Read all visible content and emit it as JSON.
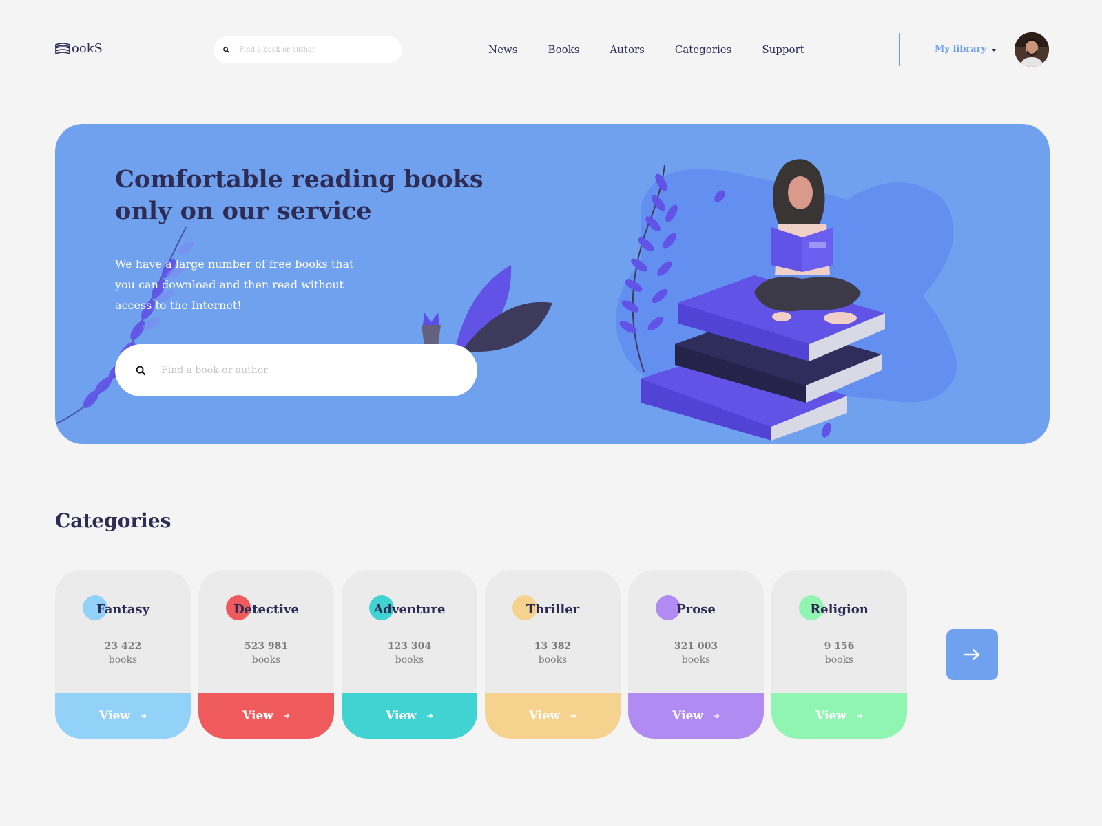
{
  "header": {
    "logo_text": "ookS",
    "search": {
      "placeholder": "Find a book or author"
    },
    "nav": [
      "News",
      "Books",
      "Autors",
      "Categories",
      "Support"
    ],
    "library_label": "My library"
  },
  "hero": {
    "title_line1": "Comfortable reading books",
    "title_line2": "only on our service",
    "description_line1": "We have a large number of free books that",
    "description_line2": "you can download and then read without",
    "description_line3": "access to the Internet!",
    "search": {
      "placeholder": "Find a book or author"
    }
  },
  "categories": {
    "title": "Categories",
    "items": [
      {
        "name": "Fantasy",
        "count": "23 422",
        "unit": "books",
        "action": "View",
        "color": "#93d2f8"
      },
      {
        "name": "Detective",
        "count": "523 981",
        "unit": "books",
        "action": "View",
        "color": "#ef5b5d"
      },
      {
        "name": "Adventure",
        "count": "123 304",
        "unit": "books",
        "action": "View",
        "color": "#40d3d2"
      },
      {
        "name": "Thriller",
        "count": "13 382",
        "unit": "books",
        "action": "View",
        "color": "#f6d28f"
      },
      {
        "name": "Prose",
        "count": "321 003",
        "unit": "books",
        "action": "View",
        "color": "#b08cf2"
      },
      {
        "name": "Religion",
        "count": "9 156",
        "unit": "books",
        "action": "View",
        "color": "#8ff5b0"
      }
    ]
  },
  "colors": {
    "accent": "#6fa1ee",
    "text_dark": "#2e2b55",
    "background": "#f4f4f4",
    "card": "#ebebeb"
  },
  "icons": [
    "books-logo-icon",
    "search-icon",
    "caret-down-icon",
    "arrow-right-icon"
  ]
}
